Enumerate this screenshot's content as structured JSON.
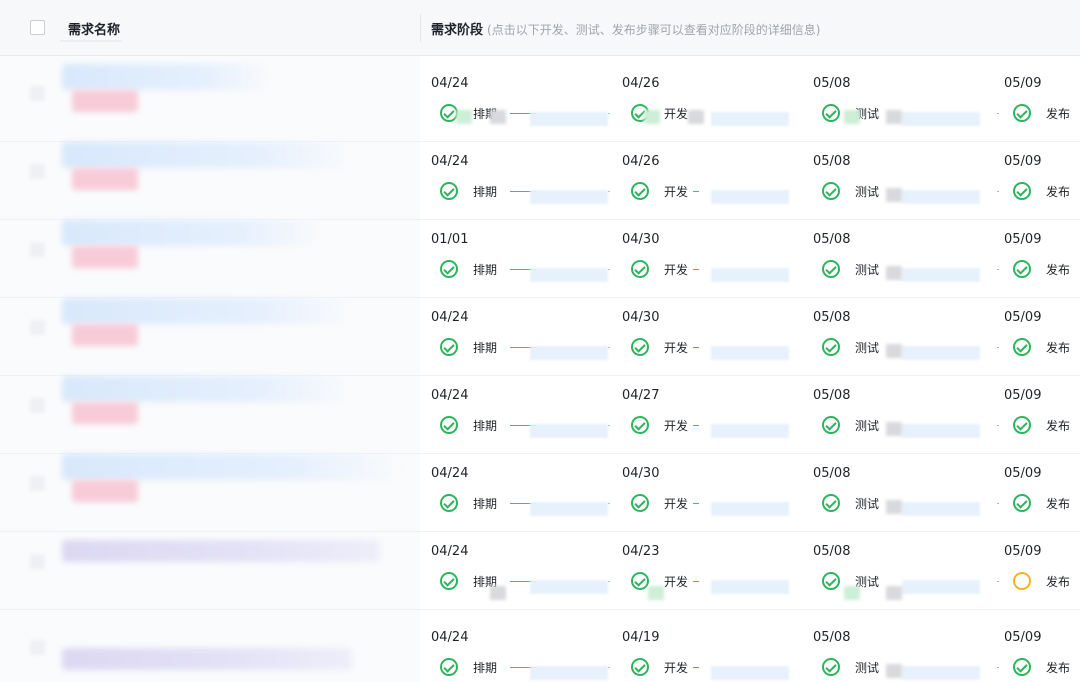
{
  "header": {
    "name_col": "需求名称",
    "stage_col": "需求阶段",
    "stage_hint": "(点击以下开发、测试、发布步骤可以查看对应阶段的详细信息)"
  },
  "stages": [
    "排期",
    "开发",
    "测试",
    "发布"
  ],
  "rows": [
    {
      "dates": [
        "04/24",
        "04/26",
        "05/08",
        "05/09"
      ],
      "status": [
        "done",
        "done",
        "done",
        "done"
      ]
    },
    {
      "dates": [
        "04/24",
        "04/26",
        "05/08",
        "05/09"
      ],
      "status": [
        "done",
        "done",
        "done",
        "done"
      ]
    },
    {
      "dates": [
        "01/01",
        "04/30",
        "05/08",
        "05/09"
      ],
      "status": [
        "done",
        "done",
        "done",
        "done"
      ]
    },
    {
      "dates": [
        "04/24",
        "04/30",
        "05/08",
        "05/09"
      ],
      "status": [
        "done",
        "done",
        "done",
        "done"
      ]
    },
    {
      "dates": [
        "04/24",
        "04/27",
        "05/08",
        "05/09"
      ],
      "status": [
        "done",
        "done",
        "done",
        "done"
      ]
    },
    {
      "dates": [
        "04/24",
        "04/30",
        "05/08",
        "05/09"
      ],
      "status": [
        "done",
        "done",
        "done",
        "done"
      ]
    },
    {
      "dates": [
        "04/24",
        "04/23",
        "05/08",
        "05/09"
      ],
      "status": [
        "done",
        "done",
        "done",
        "pending"
      ]
    },
    {
      "dates": [
        "04/24",
        "04/19",
        "05/08",
        "05/09"
      ],
      "status": [
        "done",
        "done",
        "done",
        "done"
      ]
    }
  ],
  "colors": {
    "done": "#2db55d",
    "pending": "#f5b321",
    "connector": "#4a9ef3",
    "header_bg": "#f7f8fa"
  },
  "icons": {
    "done": "check-circle-icon",
    "pending": "pending-circle-icon"
  }
}
